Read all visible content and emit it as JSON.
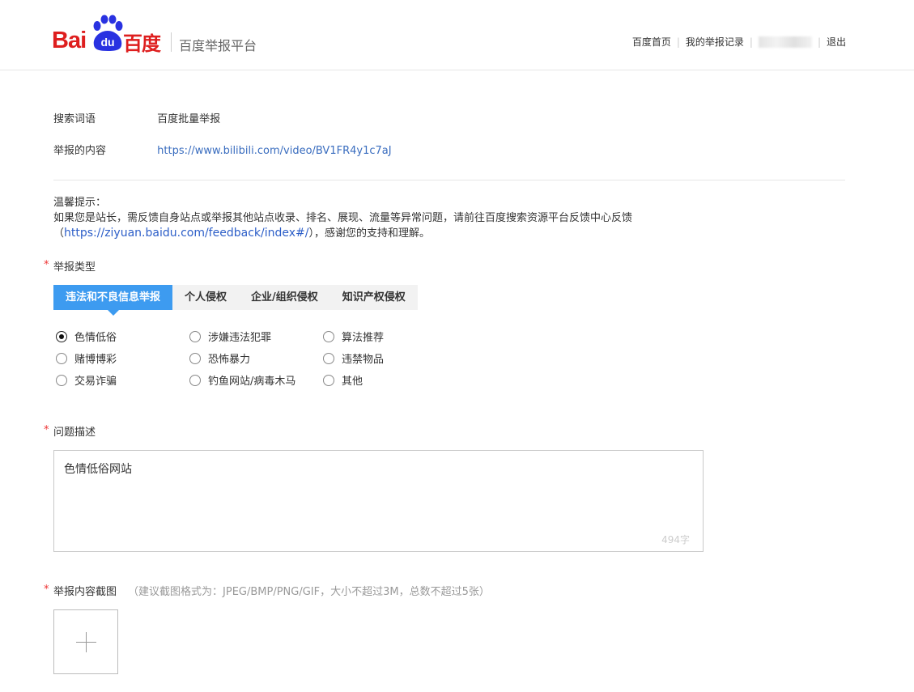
{
  "header": {
    "logo_bai": "Bai",
    "logo_du": "du",
    "logo_cn": "百度",
    "platform_title": "百度举报平台",
    "nav": {
      "home": "百度首页",
      "records": "我的举报记录",
      "logout": "退出"
    }
  },
  "info": {
    "search_term_label": "搜索词语",
    "search_term_value": "百度批量举报",
    "content_label": "举报的内容",
    "content_value": "https://www.bilibili.com/video/BV1FR4y1c7aJ"
  },
  "tips": {
    "title": "温馨提示：",
    "text_before": "如果您是站长，需反馈自身站点或举报其他站点收录、排名、展现、流量等异常问题，请前往百度搜索资源平台反馈中心反馈（",
    "link": "https://ziyuan.baidu.com/feedback/index#/",
    "text_after": "），感谢您的支持和理解。"
  },
  "report_type": {
    "label": "举报类型",
    "tabs": [
      "违法和不良信息举报",
      "个人侵权",
      "企业/组织侵权",
      "知识产权侵权"
    ],
    "active_tab": 0,
    "options": [
      "色情低俗",
      "涉嫌违法犯罪",
      "算法推荐",
      "赌博博彩",
      "恐怖暴力",
      "违禁物品",
      "交易诈骗",
      "钓鱼网站/病毒木马",
      "其他"
    ],
    "selected_option": "色情低俗"
  },
  "description": {
    "label": "问题描述",
    "value": "色情低俗网站",
    "count": "494字"
  },
  "screenshot": {
    "label": "举报内容截图",
    "hint": "（建议截图格式为：JPEG/BMP/PNG/GIF，大小不超过3M，总数不超过5张）"
  },
  "colors": {
    "brand_red": "#de1e1e",
    "brand_blue": "#2932e1",
    "tab_active": "#3d9bf0",
    "link": "#2c5ec8",
    "required": "#e33333"
  }
}
